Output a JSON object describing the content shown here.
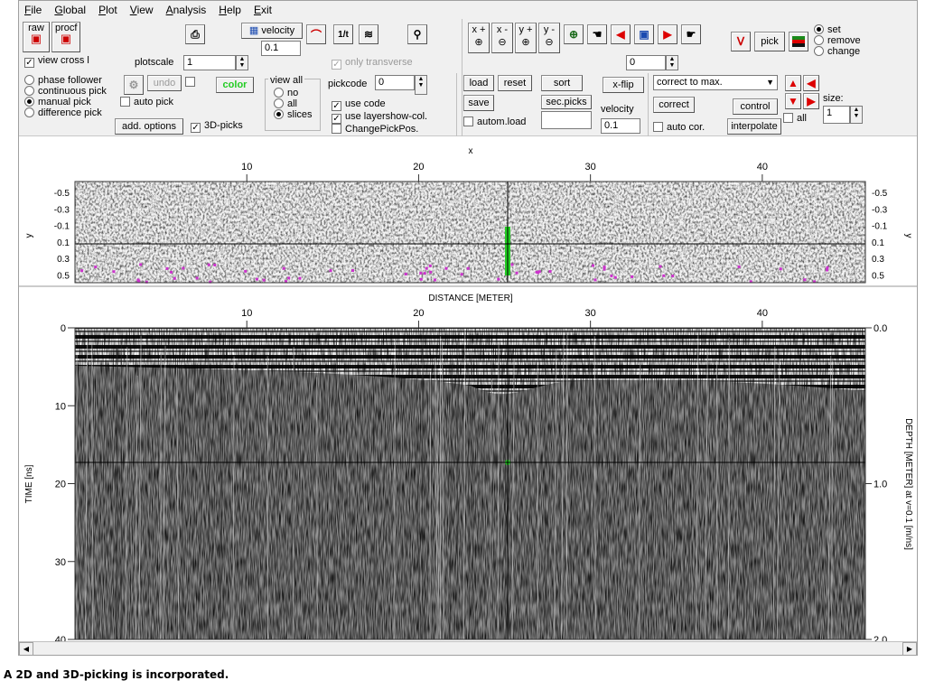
{
  "menu": [
    "File",
    "Global",
    "Plot",
    "View",
    "Analysis",
    "Help",
    "Exit"
  ],
  "toolbar": {
    "raw_label": "raw",
    "procf_label": "procf",
    "view_cross_label": "view cross l",
    "plotscale_label": "plotscale",
    "plotscale_value": "1",
    "velocity_label": "velocity",
    "velocity_value": "0.1",
    "only_transverse_label": "only transverse",
    "ratio_label": "1/t",
    "zoom_labels": [
      "x +",
      "x -",
      "y +",
      "y -"
    ],
    "position_value": "0",
    "pick_label": "pick",
    "pick_mode_options": [
      "set",
      "remove",
      "change"
    ],
    "pick_mode_selected": "set",
    "pick_methods": [
      "phase follower",
      "continuous pick",
      "manual pick",
      "difference pick"
    ],
    "pick_method_selected": "manual pick",
    "undo_label": "undo",
    "auto_pick_label": "auto pick",
    "color_label": "color",
    "add_options_label": "add. options",
    "three_d_picks_label": "3D-picks",
    "view_all_label": "view all",
    "view_all_options": [
      "no",
      "all",
      "slices"
    ],
    "view_all_selected": "slices",
    "pickcode_label": "pickcode",
    "pickcode_value": "0",
    "use_code_label": "use code",
    "use_layershow_label": "use layershow-col.",
    "change_pick_pos_label": "ChangePickPos.",
    "load_label": "load",
    "reset_label": "reset",
    "sort_label": "sort",
    "save_label": "save",
    "sec_picks_label": "sec.picks",
    "autom_load_label": "autom.load",
    "xflip_label": "x-flip",
    "velocity2_label": "velocity",
    "velocity2_value": "0.1",
    "correct_mode_value": "correct to max.",
    "correct_label": "correct",
    "control_label": "control",
    "auto_cor_label": "auto cor.",
    "interpolate_label": "interpolate",
    "all_label": "all",
    "size_label": "size:",
    "size_value": "1"
  },
  "top_plot": {
    "xlabel": "x",
    "x_ticks": [
      "10",
      "20",
      "30",
      "40"
    ],
    "ylabel": "y",
    "y_ticks": [
      "-0.5",
      "-0.3",
      "-0.1",
      "0.1",
      "0.3",
      "0.5"
    ]
  },
  "bottom_plot": {
    "xlabel": "DISTANCE [METER]",
    "x_ticks": [
      "10",
      "20",
      "30",
      "40"
    ],
    "ylabel": "TIME [ns]",
    "y_ticks": [
      "0",
      "10",
      "20",
      "30",
      "40"
    ],
    "right_label": "DEPTH [METER] at v=0.1 [m/ns]",
    "right_ticks": [
      "0.0",
      "1.0",
      "2.0"
    ]
  },
  "caption": "A 2D and 3D-picking is incorporated.",
  "colors": {
    "pick_marker": "#22cc22",
    "pick_magenta": "#cc33cc",
    "arrow_red": "#dd0000",
    "color_button_text": "#22cc22"
  }
}
